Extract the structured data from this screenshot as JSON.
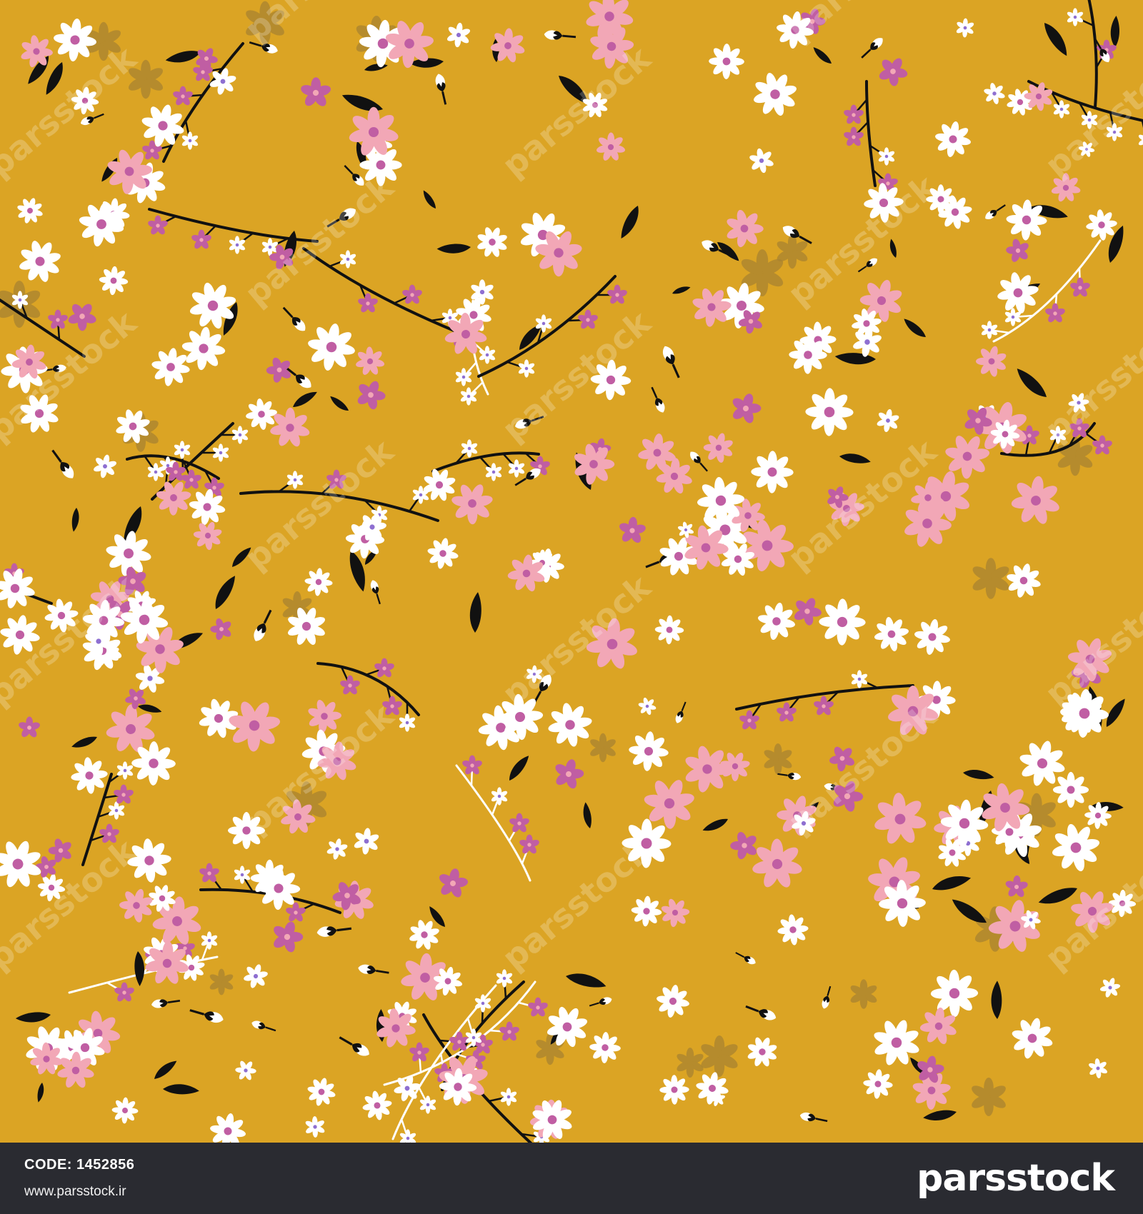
{
  "footer": {
    "code_label": "CODE:",
    "code_value": "1452856",
    "website": "www.parsstock.ir",
    "brand": "parsstock"
  },
  "watermark": {
    "text": "parsstock"
  },
  "colors": {
    "background": "#dba424",
    "footer": "#2a2b31",
    "petal_white": "#ffffff",
    "petal_pink": "#f2a7b6",
    "petal_magenta": "#c05ea3",
    "center_violet": "#8e6fd1",
    "stem_black": "#111111",
    "ghost_flower": "#a98330"
  },
  "icons": {
    "flower": "flower-icon",
    "leaf": "leaf-icon",
    "branch": "branch-icon",
    "logo_mark": "parsstock-logo-icon"
  }
}
